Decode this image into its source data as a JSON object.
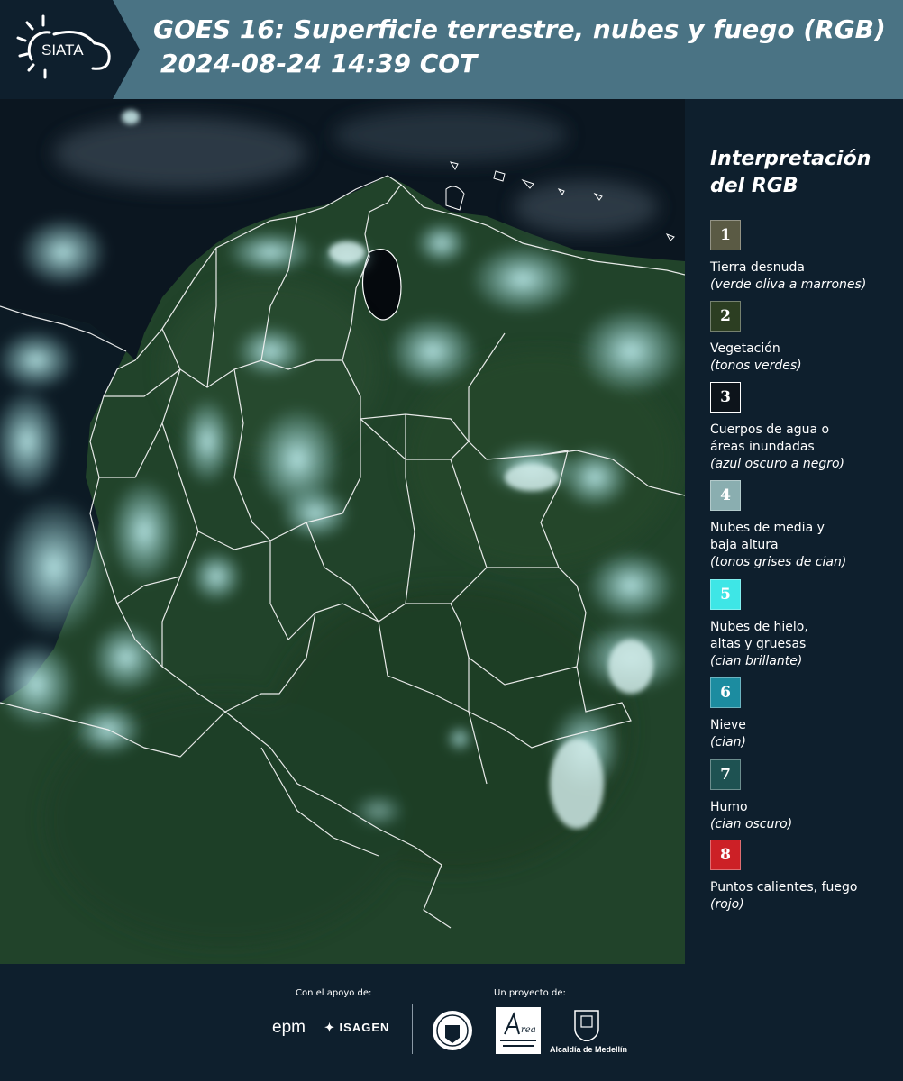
{
  "header": {
    "logo_text": "SIATA",
    "title_line1": "GOES 16: Superficie terrestre, nubes y fuego (RGB)",
    "title_line2": "2024-08-24 14:39 COT"
  },
  "legend": {
    "title_line1": "Interpretación",
    "title_line2": "del RGB",
    "items": [
      {
        "number": "1",
        "label": "Tierra desnuda",
        "sub": "(verde oliva a marrones)",
        "color": "#5a5a44"
      },
      {
        "number": "2",
        "label": "Vegetación",
        "sub": "(tonos verdes)",
        "color": "#2c3e22"
      },
      {
        "number": "3",
        "label": "Cuerpos de agua o áreas inundadas",
        "sub": "(azul oscuro a negro)",
        "color": "#0d141b"
      },
      {
        "number": "4",
        "label": "Nubes de media y baja altura",
        "sub": "(tonos grises de cian)",
        "color": "#8aaeb0"
      },
      {
        "number": "5",
        "label": "Nubes de hielo, altas y gruesas",
        "sub": "(cian brillante)",
        "color": "#3ee6e6"
      },
      {
        "number": "6",
        "label": "Nieve",
        "sub": "(cian)",
        "color": "#1c8ca0"
      },
      {
        "number": "7",
        "label": "Humo",
        "sub": "(cian oscuro)",
        "color": "#1e5252"
      },
      {
        "number": "8",
        "label": "Puntos calientes, fuego",
        "sub": "(rojo)",
        "color": "#cc2026"
      }
    ]
  },
  "footer": {
    "support_label": "Con el apoyo de:",
    "project_label": "Un proyecto de:",
    "epm": "epm",
    "isagen": "ISAGEN",
    "alcaldia": "Alcaldía de Medellín"
  }
}
